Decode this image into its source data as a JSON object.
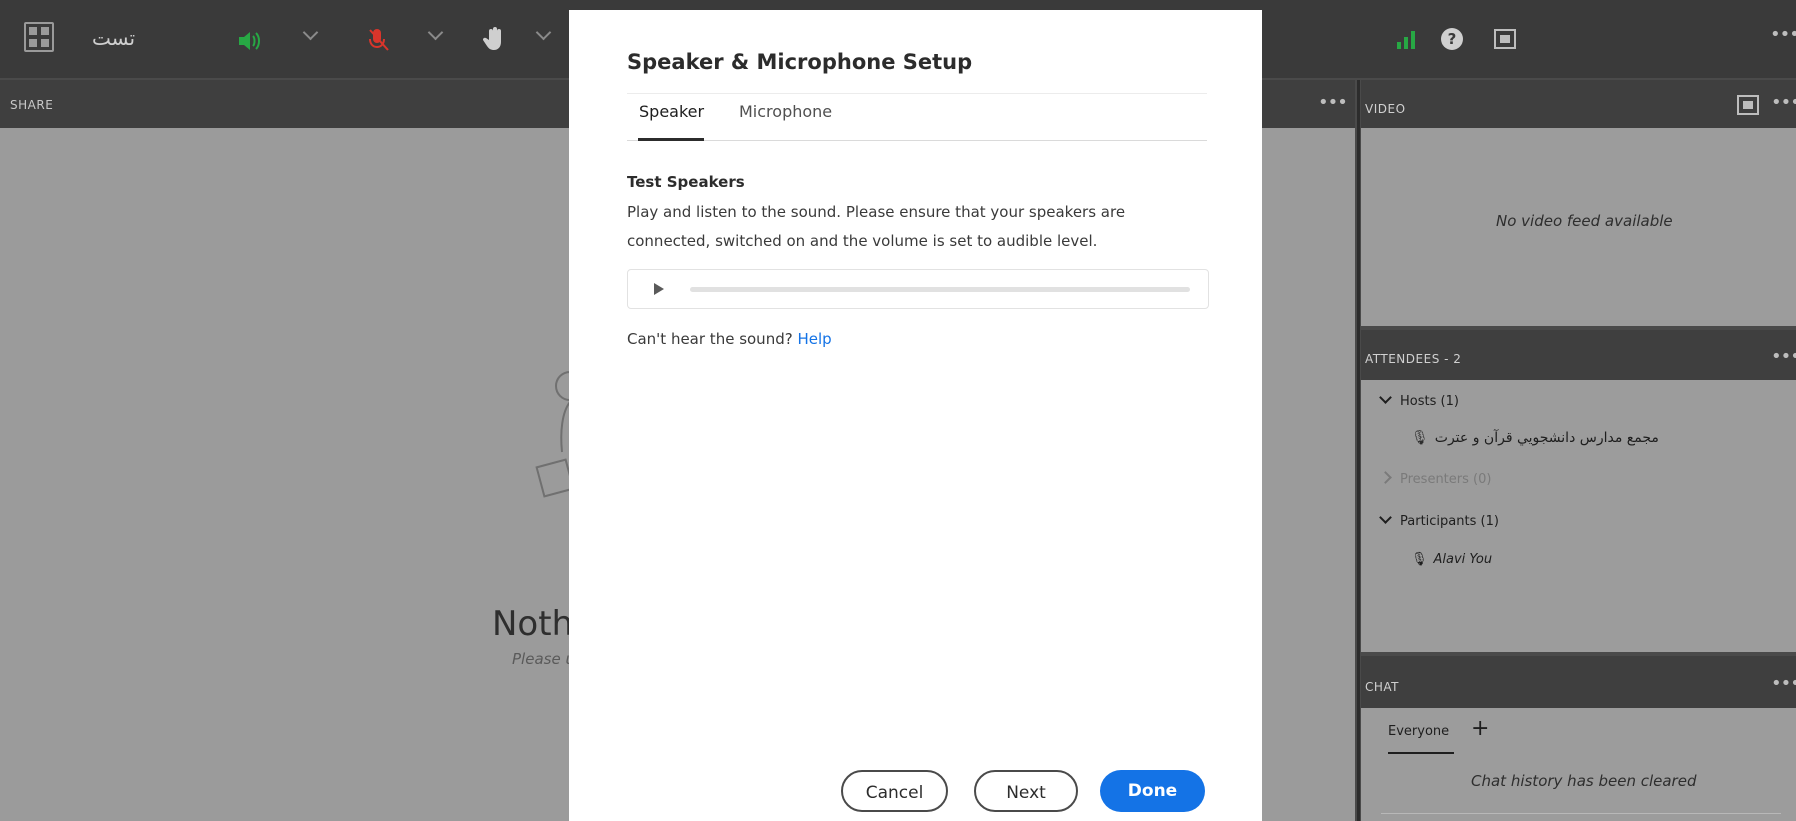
{
  "topbar": {
    "meeting_name": "تست",
    "icons": [
      "fullscreen-icon",
      "speaker-icon",
      "microphone-icon",
      "raise-hand-icon",
      "signal-icon",
      "help-icon",
      "layout-icon",
      "more-icon"
    ]
  },
  "share_pod": {
    "title": "SHARE",
    "more": "•••",
    "empty_title_fragment": "Noth",
    "empty_sub_fragment": "Please u"
  },
  "video_pod": {
    "title": "VIDEO",
    "more": "•••",
    "message": "No video feed available"
  },
  "attendees_pod": {
    "title": "ATTENDEES - 2",
    "more": "•••",
    "hosts_label": "Hosts (1)",
    "host_name": "مجمع مدارس دانشجويي قرآن و عترت",
    "presenters_label": "Presenters (0)",
    "participants_label": "Participants (1)",
    "participant_name": "Alavi You"
  },
  "chat_pod": {
    "title": "CHAT",
    "more": "•••",
    "tab": "Everyone",
    "add": "+",
    "message": "Chat history has been cleared"
  },
  "dialog": {
    "title": "Speaker & Microphone Setup",
    "tabs": [
      "Speaker",
      "Microphone"
    ],
    "active_tab": "Speaker",
    "section_title": "Test Speakers",
    "description_line1": "Play and listen to the sound. Please ensure that your speakers are",
    "description_line2": "connected, switched on and the volume is set to audible level.",
    "cant_hear": "Can't hear the sound?",
    "help_link": "Help",
    "buttons": {
      "cancel": "Cancel",
      "next": "Next",
      "done": "Done"
    }
  },
  "colors": {
    "accent": "#1473e6",
    "speaker_icon": "#27a844",
    "mic_icon": "#d9352b",
    "signal": "#27a844"
  }
}
